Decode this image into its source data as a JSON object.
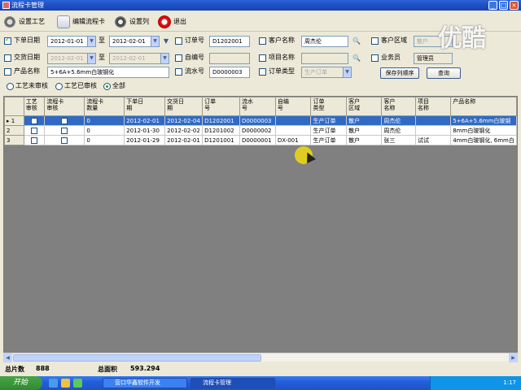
{
  "window": {
    "title": "流程卡管理",
    "min": "_",
    "max": "□",
    "close": "×"
  },
  "toolbar": {
    "set_process": "设置工艺",
    "edit_card": "编辑流程卡",
    "set_columns": "设置列",
    "exit": "退出"
  },
  "filters": {
    "order_date_label": "下单日期",
    "order_date_from": "2012-01-01",
    "order_date_sep": "至",
    "order_date_to": "2012-02-01",
    "delivery_date_label": "交货日期",
    "delivery_date_from": "2012-02-01",
    "delivery_date_sep": "至",
    "delivery_date_to": "2012-02-01",
    "product_name_label": "产品名称",
    "product_name_value": "5+6A+5.6mm白玻钢化",
    "order_no_label": "订单号",
    "order_no_value": "D1202001",
    "self_no_label": "自编号",
    "self_no_value": "",
    "flow_no_label": "流水号",
    "flow_no_value": "D0000003",
    "customer_name_label": "客户名称",
    "customer_name_value": "周杰伦",
    "project_name_label": "项目名称",
    "project_name_value": "",
    "order_type_label": "订单类型",
    "order_type_value": "生产订单",
    "customer_area_label": "客户区域",
    "customer_area_value": "散户",
    "salesman_label": "业务员",
    "salesman_value": "管理员",
    "save_order_btn": "保存列顺序",
    "query_btn": "查询",
    "search_glyph": "🔍",
    "dropdown_glyph": "▼",
    "radio_uncrafted": "工艺未审核",
    "radio_crafted": "工艺已审核",
    "radio_all": "全部"
  },
  "grid": {
    "columns": [
      "",
      "工艺\n审核",
      "流程卡\n审核",
      "流程卡\n数量",
      "下单日\n期",
      "交货日\n期",
      "订单\n号",
      "流水\n号",
      "自编\n号",
      "订单\n类型",
      "客户\n区域",
      "客户\n名称",
      "项目\n名称",
      "产品名称"
    ],
    "rows": [
      {
        "rh": "▸ 1",
        "qty": "0",
        "order_date": "2012-02-01",
        "delivery_date": "2012-02-04",
        "order_no": "D1202001",
        "flow_no": "D0000003",
        "self_no": "",
        "order_type": "生产订单",
        "area": "散户",
        "customer": "周杰伦",
        "project": "",
        "product": "5+6A+5.6mm白玻钢"
      },
      {
        "rh": "2",
        "qty": "0",
        "order_date": "2012-01-30",
        "delivery_date": "2012-02-02",
        "order_no": "D1201002",
        "flow_no": "D0000002",
        "self_no": "",
        "order_type": "生产订单",
        "area": "散户",
        "customer": "周杰伦",
        "project": "",
        "product": "8mm白玻钢化"
      },
      {
        "rh": "3",
        "qty": "0",
        "order_date": "2012-01-29",
        "delivery_date": "2012-02-01",
        "order_no": "D1201001",
        "flow_no": "D0000001",
        "self_no": "DX-001",
        "order_type": "生产订单",
        "area": "散户",
        "customer": "张三",
        "project": "试试",
        "product": "4mm白玻钢化, 6mm白"
      }
    ]
  },
  "status": {
    "total_pieces_label": "总片数",
    "total_pieces_value": "888",
    "total_area_label": "总面积",
    "total_area_value": "593.294"
  },
  "taskbar": {
    "start": "开始",
    "task1": "营口华鑫软件开发",
    "task2": "流程卡管理",
    "clock": "1:17"
  },
  "watermark": "优酷"
}
